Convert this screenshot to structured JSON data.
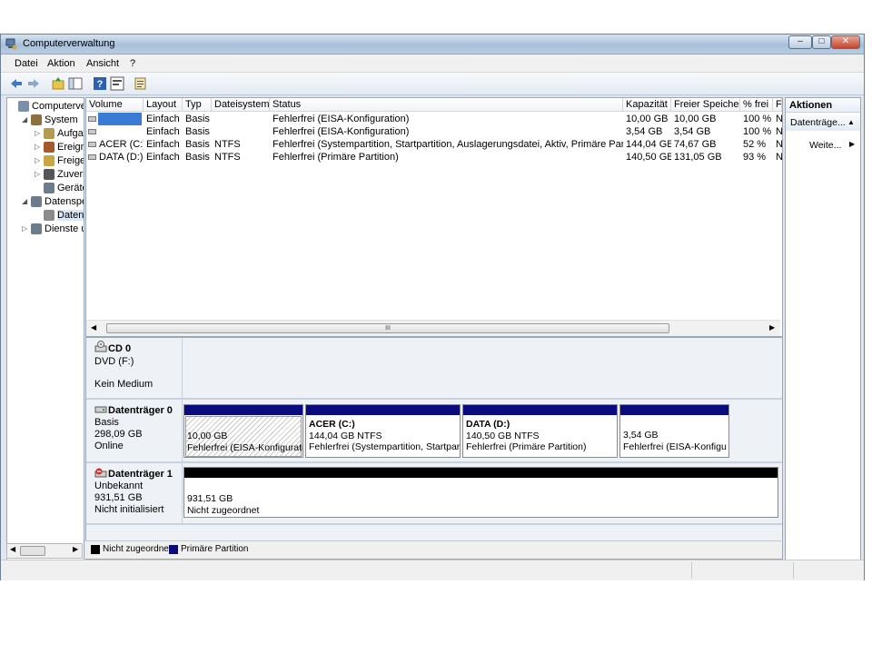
{
  "window": {
    "title": "Computerverwaltung",
    "minimize": "–",
    "maximize": "□",
    "close": "✕"
  },
  "menu": {
    "items": [
      "Datei",
      "Aktion",
      "Ansicht",
      "?"
    ]
  },
  "toolbar": {
    "icons": [
      "back-icon",
      "forward-icon",
      "up-folder-icon",
      "show-hide-tree-icon",
      "help-icon",
      "properties-icon",
      "export-icon"
    ]
  },
  "tree": {
    "items": [
      {
        "label": "Computerverwaltung (Lokal)",
        "indent": 0,
        "expander": "",
        "icon": "computer-icon",
        "color": "#7a8fa8"
      },
      {
        "label": "System",
        "indent": 1,
        "expander": "◢",
        "icon": "tools-icon",
        "color": "#8c6e3f"
      },
      {
        "label": "Aufgabenplanung",
        "indent": 2,
        "expander": "▷",
        "icon": "clock-icon",
        "color": "#b59b4f"
      },
      {
        "label": "Ereignisanzeige",
        "indent": 2,
        "expander": "▷",
        "icon": "event-viewer-icon",
        "color": "#a65a2a"
      },
      {
        "label": "Freigegebene Ordner",
        "indent": 2,
        "expander": "▷",
        "icon": "shared-folder-icon",
        "color": "#c9a642"
      },
      {
        "label": "Zuverlässigkeit und Leistung",
        "indent": 2,
        "expander": "▷",
        "icon": "performance-icon",
        "color": "#555555"
      },
      {
        "label": "Geräte-Manager",
        "indent": 2,
        "expander": "",
        "icon": "device-manager-icon",
        "color": "#6b7c8d"
      },
      {
        "label": "Datenspeicher",
        "indent": 1,
        "expander": "◢",
        "icon": "storage-icon",
        "color": "#6b7c8d"
      },
      {
        "label": "Datenträgerverwaltung",
        "indent": 2,
        "expander": "",
        "icon": "disk-management-icon",
        "color": "#8a8a8a",
        "selected": true
      },
      {
        "label": "Dienste und Anwendungen",
        "indent": 1,
        "expander": "▷",
        "icon": "services-icon",
        "color": "#6b7c8d"
      }
    ]
  },
  "volume_table": {
    "columns": [
      "Volume",
      "Layout",
      "Typ",
      "Dateisystem",
      "Status",
      "Kapazität",
      "Freier Speicher",
      "% frei",
      "F"
    ],
    "rows": [
      {
        "volume": "",
        "layout": "Einfach",
        "typ": "Basis",
        "fs": "",
        "status": "Fehlerfrei (EISA-Konfiguration)",
        "cap": "10,00 GB",
        "free": "10,00 GB",
        "pct": "100 %",
        "f": "N",
        "selected": true
      },
      {
        "volume": "",
        "layout": "Einfach",
        "typ": "Basis",
        "fs": "",
        "status": "Fehlerfrei (EISA-Konfiguration)",
        "cap": "3,54 GB",
        "free": "3,54 GB",
        "pct": "100 %",
        "f": "N"
      },
      {
        "volume": "ACER (C:)",
        "layout": "Einfach",
        "typ": "Basis",
        "fs": "NTFS",
        "status": "Fehlerfrei (Systempartition, Startpartition, Auslagerungsdatei, Aktiv, Primäre Partition)",
        "cap": "144,04 GB",
        "free": "74,67 GB",
        "pct": "52 %",
        "f": "N"
      },
      {
        "volume": "DATA (D:)",
        "layout": "Einfach",
        "typ": "Basis",
        "fs": "NTFS",
        "status": "Fehlerfrei (Primäre Partition)",
        "cap": "140,50 GB",
        "free": "131,05 GB",
        "pct": "93 %",
        "f": "N"
      }
    ],
    "scroll_grip": "III"
  },
  "disks": {
    "cd0": {
      "name": "CD 0",
      "line2": "DVD (F:)",
      "line3": "Kein Medium"
    },
    "disk0": {
      "name": "Datenträger 0",
      "line2": "Basis",
      "line3": "298,09 GB",
      "line4": "Online",
      "partitions": [
        {
          "title": "",
          "size": "10,00 GB",
          "status": "Fehlerfrei (EISA-Konfigurati"
        },
        {
          "title": "ACER  (C:)",
          "size": "144,04 GB NTFS",
          "status": "Fehlerfrei (Systempartition, Startpart"
        },
        {
          "title": "DATA  (D:)",
          "size": "140,50 GB NTFS",
          "status": "Fehlerfrei (Primäre Partition)"
        },
        {
          "title": "",
          "size": "3,54 GB",
          "status": "Fehlerfrei (EISA-Konfigu"
        }
      ]
    },
    "disk1": {
      "name": "Datenträger 1",
      "line2": "Unbekannt",
      "line3": "931,51 GB",
      "line4": "Nicht initialisiert",
      "part_size": "931,51 GB",
      "part_status": "Nicht zugeordnet"
    }
  },
  "legend": {
    "unallocated": "Nicht zugeordnet",
    "primary": "Primäre Partition",
    "unallocated_color": "#000000",
    "primary_color": "#0b0b80"
  },
  "actions": {
    "header": "Aktionen",
    "section": "Datenträge...",
    "item": "Weite..."
  },
  "colors": {
    "selection": "#3a7bd5",
    "partition_header": "#0b0b80",
    "title_bar": "#b8cde3"
  }
}
